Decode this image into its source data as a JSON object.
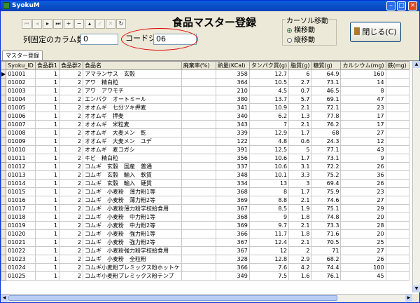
{
  "window": {
    "title": "SyokuM"
  },
  "header": {
    "page_title": "食品マスター登録",
    "fixed_columns_label": "列固定のカラム数",
    "fixed_columns_value": "0",
    "code_jump_label": "コードジャンプ",
    "code_jump_value": "06",
    "cursor_group_label": "カーソル移動",
    "radio_horizontal": "横移動",
    "radio_vertical": "縦移動",
    "close_label": "閉じる(C)"
  },
  "tab": {
    "label": "マスター登録"
  },
  "table": {
    "headers": [
      "Syoku_ID",
      "食品群1",
      "食品群2",
      "食品名",
      "廃棄率(%)",
      "熱量(KCal)",
      "タンパク質(g)",
      "脂質(g)",
      "糖質(g)",
      "カルシウム(mg)",
      "鉄(mg)"
    ],
    "rows": [
      [
        "01001",
        "1",
        "2",
        "アマランサス　玄穀",
        "",
        "358",
        "12.7",
        "6",
        "64.9",
        "160",
        ""
      ],
      [
        "01002",
        "1",
        "2",
        "アワ　精白粒",
        "",
        "364",
        "10.5",
        "2.7",
        "73.1",
        "14",
        ""
      ],
      [
        "01003",
        "1",
        "2",
        "アワ　アワモチ",
        "",
        "210",
        "4.5",
        "0.7",
        "46.5",
        "8",
        ""
      ],
      [
        "01004",
        "1",
        "2",
        "エンバク　オートミール",
        "",
        "380",
        "13.7",
        "5.7",
        "69.1",
        "47",
        ""
      ],
      [
        "01005",
        "1",
        "2",
        "オオムギ　七分ツキ押麦",
        "",
        "341",
        "10.9",
        "2.1",
        "72.1",
        "23",
        ""
      ],
      [
        "01006",
        "1",
        "2",
        "オオムギ　押麦",
        "",
        "340",
        "6.2",
        "1.3",
        "77.8",
        "17",
        ""
      ],
      [
        "01007",
        "1",
        "2",
        "オオムギ　米粒麦",
        "",
        "343",
        "7",
        "2.1",
        "76.2",
        "17",
        ""
      ],
      [
        "01008",
        "1",
        "2",
        "オオムギ　大麦メン　乾",
        "",
        "339",
        "12.9",
        "1.7",
        "68",
        "27",
        ""
      ],
      [
        "01009",
        "1",
        "2",
        "オオムギ　大麦メン　ユデ",
        "",
        "122",
        "4.8",
        "0.6",
        "24.3",
        "12",
        ""
      ],
      [
        "01010",
        "1",
        "2",
        "オオムギ　麦コガシ",
        "",
        "391",
        "12.5",
        "5",
        "77.1",
        "43",
        ""
      ],
      [
        "01011",
        "1",
        "2",
        "キビ　精白粒",
        "",
        "356",
        "10.6",
        "1.7",
        "73.1",
        "9",
        ""
      ],
      [
        "01012",
        "1",
        "2",
        "コムギ　玄穀　国産　普通",
        "",
        "337",
        "10.6",
        "3.1",
        "72.2",
        "26",
        ""
      ],
      [
        "01013",
        "1",
        "2",
        "コムギ　玄穀　輸入　軟質",
        "",
        "348",
        "10.1",
        "3.3",
        "75.2",
        "36",
        ""
      ],
      [
        "01014",
        "1",
        "2",
        "コムギ　玄穀　輸入　硬質",
        "",
        "334",
        "13",
        "3",
        "69.4",
        "26",
        ""
      ],
      [
        "01015",
        "1",
        "2",
        "コムギ　小麦粉　薄力粉1等",
        "",
        "368",
        "8",
        "1.7",
        "75.9",
        "23",
        ""
      ],
      [
        "01016",
        "1",
        "2",
        "コムギ　小麦粉　薄力粉2等",
        "",
        "369",
        "8.8",
        "2.1",
        "74.6",
        "27",
        ""
      ],
      [
        "01017",
        "1",
        "2",
        "コムギ　小麦粉薄力粉学校給食用",
        "",
        "367",
        "8.5",
        "1.9",
        "75.1",
        "29",
        ""
      ],
      [
        "01018",
        "1",
        "2",
        "コムギ　小麦粉　中力粉1等",
        "",
        "368",
        "9",
        "1.8",
        "74.8",
        "20",
        ""
      ],
      [
        "01019",
        "1",
        "2",
        "コムギ　小麦粉　中力粉2等",
        "",
        "369",
        "9.7",
        "2.1",
        "73.3",
        "28",
        ""
      ],
      [
        "01020",
        "1",
        "2",
        "コムギ　小麦粉　強力粉1等",
        "",
        "366",
        "11.7",
        "1.8",
        "71.6",
        "20",
        ""
      ],
      [
        "01021",
        "1",
        "2",
        "コムギ　小麦粉　強力粉2等",
        "",
        "367",
        "12.4",
        "2.1",
        "70.5",
        "25",
        ""
      ],
      [
        "01022",
        "1",
        "2",
        "コムギ　小麦粉強力粉学校給食用",
        "",
        "367",
        "12",
        "2",
        "71",
        "27",
        ""
      ],
      [
        "01023",
        "1",
        "2",
        "コムギ　小麦粉　全粒粉",
        "",
        "328",
        "12.8",
        "2.9",
        "68.2",
        "26",
        ""
      ],
      [
        "01024",
        "1",
        "2",
        "コムギ小麦粉プレミックス粉ホットケ",
        "",
        "366",
        "7.6",
        "4.2",
        "74.4",
        "100",
        ""
      ],
      [
        "01025",
        "1",
        "2",
        "コムギ小麦粉プレミックス粉テンプ",
        "",
        "349",
        "7.5",
        "1.6",
        "76.1",
        "45",
        ""
      ]
    ]
  }
}
